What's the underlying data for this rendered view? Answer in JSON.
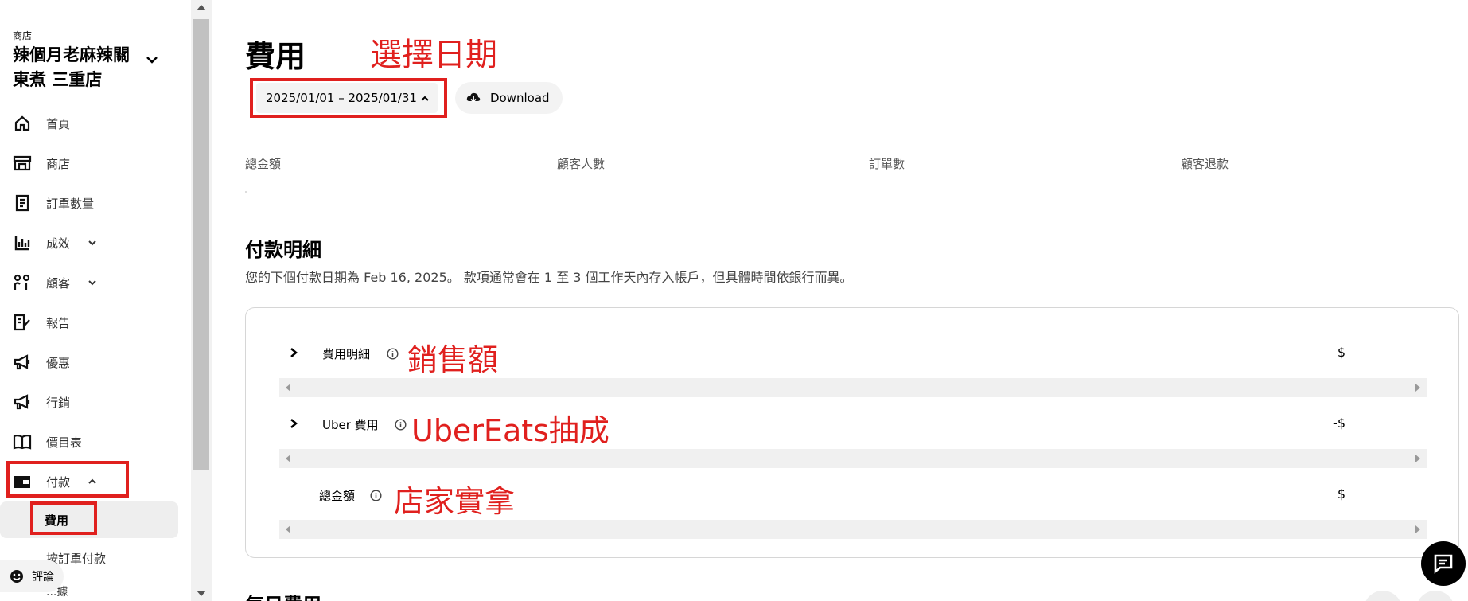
{
  "sidebar": {
    "store_caption": "商店",
    "store_name": "辣個月老麻辣關東煮 三重店",
    "nav": [
      {
        "label": "首頁",
        "icon": "home-icon"
      },
      {
        "label": "商店",
        "icon": "store-icon"
      },
      {
        "label": "訂單數量",
        "icon": "receipt-icon"
      },
      {
        "label": "成效",
        "icon": "bar-chart-icon"
      },
      {
        "label": "顧客",
        "icon": "people-icon"
      },
      {
        "label": "報告",
        "icon": "report-icon"
      },
      {
        "label": "優惠",
        "icon": "megaphone-icon"
      },
      {
        "label": "行銷",
        "icon": "megaphone-icon"
      },
      {
        "label": "價目表",
        "icon": "book-icon"
      },
      {
        "label": "付款",
        "icon": "wallet-icon"
      }
    ],
    "sub_items": [
      {
        "label": "費用",
        "active": true
      },
      {
        "label": "按訂單付款",
        "active": false
      }
    ],
    "review_button": "評論",
    "peek_label": "...據"
  },
  "header": {
    "title": "費用",
    "date_range": "2025/01/01 – 2025/01/31",
    "download_label": "Download"
  },
  "annotations": {
    "select_date": "選擇日期",
    "sales": "銷售額",
    "ubereats_fee": "UberEats抽成",
    "store_net": "店家實拿",
    "color": "#e0201e"
  },
  "stats": {
    "total_amount": "總金額",
    "customers": "顧客人數",
    "orders": "訂單數",
    "refunds": "顧客退款"
  },
  "payment": {
    "title": "付款明細",
    "description": "您的下個付款日期為 Feb 16, 2025。 款項通常會在 1 至 3 個工作天內存入帳戶，但具體時間依銀行而異。",
    "rows": [
      {
        "label": "費用明細",
        "amount": "$"
      },
      {
        "label": "Uber 費用",
        "amount": "-$"
      },
      {
        "label": "總金額",
        "amount": "$"
      }
    ]
  },
  "next_section_title": "每日費用"
}
